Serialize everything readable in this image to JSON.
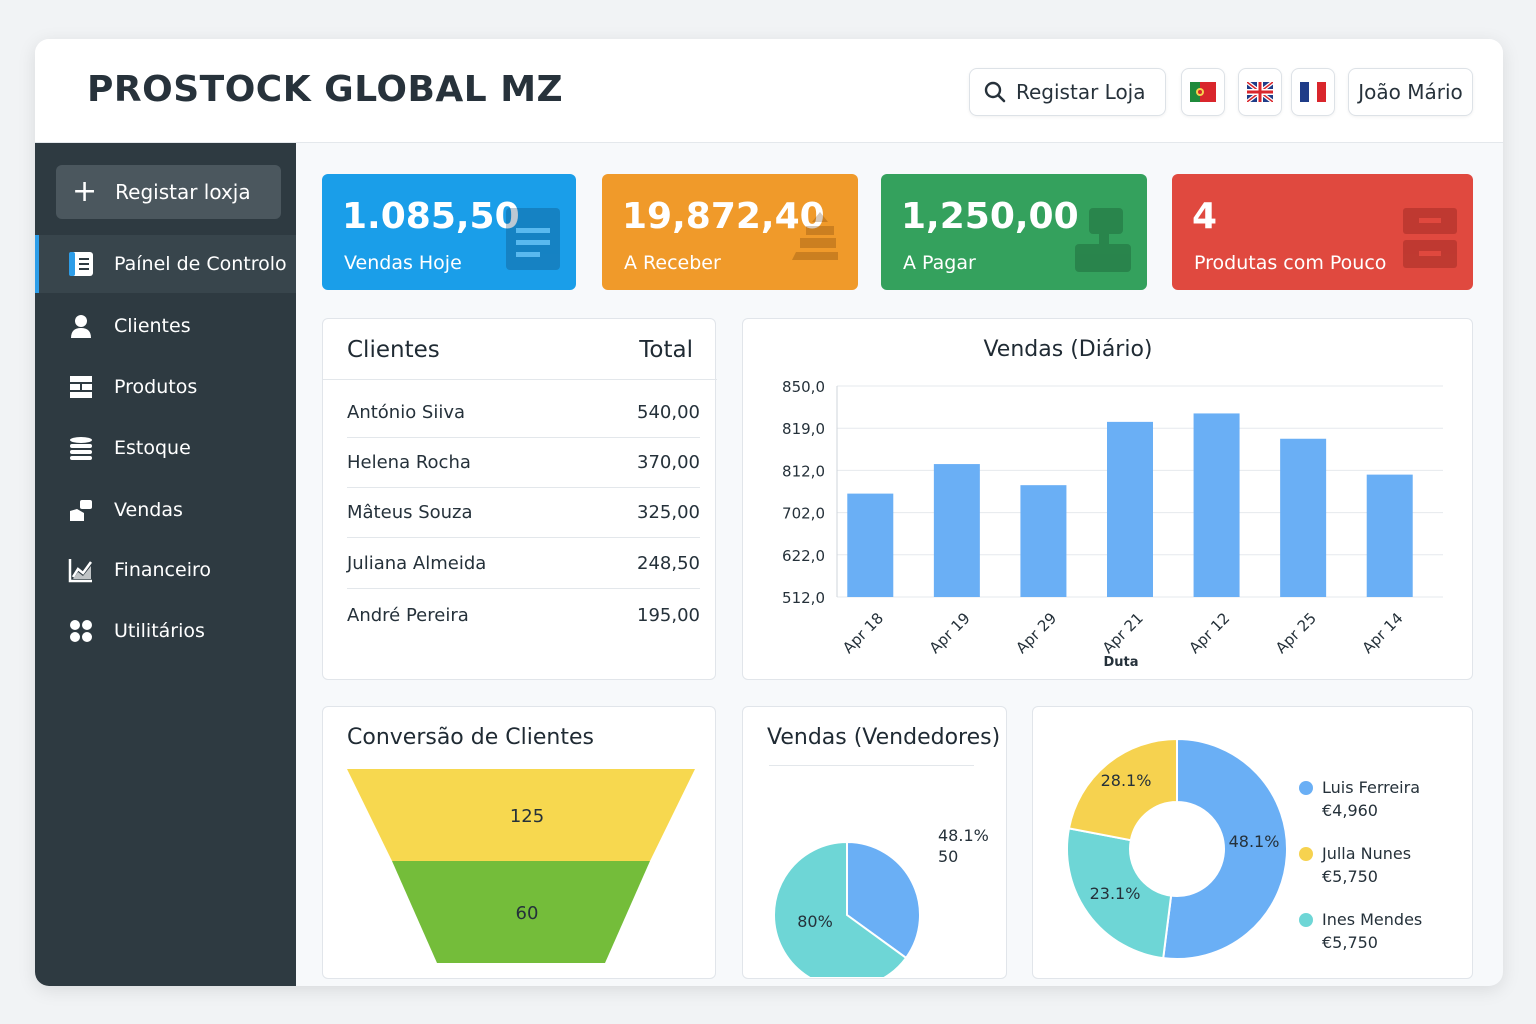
{
  "header": {
    "brand": "PROSTOCK GLOBAL MZ",
    "search_label": "Registar Loja",
    "user_name": "João Mário"
  },
  "sidebar": {
    "add_button": "Registar  loxja",
    "items": [
      {
        "label": "Paínel de Controlo",
        "icon": "dashboard-icon",
        "active": true
      },
      {
        "label": "Clientes",
        "icon": "user-icon"
      },
      {
        "label": "Produtos",
        "icon": "products-icon"
      },
      {
        "label": "Estoque",
        "icon": "stack-icon"
      },
      {
        "label": "Vendas",
        "icon": "sales-icon"
      },
      {
        "label": "Financeiro",
        "icon": "finance-chart-icon"
      },
      {
        "label": "Utilitários",
        "icon": "utilities-icon"
      }
    ]
  },
  "stats": [
    {
      "value": "1.085,50",
      "label": "Vendas Hoje",
      "color": "#1a9ee9"
    },
    {
      "value": "19,872,40",
      "label": "A Receber",
      "color": "#f09a2a"
    },
    {
      "value": "1,250,00",
      "label": "A Pagar",
      "color": "#34a15d"
    },
    {
      "value": "4",
      "label": "Produtas com Pouco",
      "color": "#e0493f"
    }
  ],
  "clients_table": {
    "title": "Clientes",
    "total_header": "Total",
    "rows": [
      {
        "name": "António Siiva",
        "total": "540,00"
      },
      {
        "name": "Helena Rocha",
        "total": "370,00"
      },
      {
        "name": "Mâteus Souza",
        "total": "325,00"
      },
      {
        "name": "Juliana Almeida",
        "total": "248,50"
      },
      {
        "name": "André Pereira",
        "total": "195,00"
      }
    ]
  },
  "chart_data": [
    {
      "type": "bar",
      "title": "Vendas (Diário)",
      "xlabel": "Duta",
      "ylabel": "",
      "categories": [
        "Apr 18",
        "Apr 19",
        "Apr 29",
        "Apr 21",
        "Apr 12",
        "Apr 25",
        "Apr 14"
      ],
      "y_tick_labels": [
        "850,0",
        "819,0",
        "812,0",
        "702,0",
        "622,0",
        "512,0"
      ],
      "bar_level_fraction": [
        0.49,
        0.63,
        0.53,
        0.83,
        0.87,
        0.75,
        0.58
      ],
      "color": "#6aaff5",
      "grid": true
    },
    {
      "type": "funnel",
      "title": "Conversão de Clientes",
      "stages": [
        {
          "value": 125,
          "color": "#f7d84f"
        },
        {
          "value": 60,
          "color": "#74bd3a"
        }
      ]
    },
    {
      "type": "pie",
      "title": "Vendas (Vendedores)",
      "slices": [
        {
          "label": "48.1%",
          "fraction": 0.35,
          "color": "#6aaff5"
        },
        {
          "label": "80%",
          "fraction": 0.65,
          "color": "#6ed6d6"
        }
      ],
      "side_label_pct": "48.1%",
      "side_label_value": "50"
    },
    {
      "type": "pie",
      "donut": true,
      "slices": [
        {
          "label": "48.1%",
          "fraction": 0.52,
          "color": "#6aaff5"
        },
        {
          "label": "23.1%",
          "fraction": 0.26,
          "color": "#6ed6d6"
        },
        {
          "label": "28.1%",
          "fraction": 0.22,
          "color": "#f6d24f"
        }
      ],
      "legend": [
        {
          "name": "Luis Ferreira",
          "value": "€4,960",
          "color": "#6aaff5"
        },
        {
          "name": "Julla Nunes",
          "value": "€5,750",
          "color": "#f6d24f"
        },
        {
          "name": "Ines Mendes",
          "value": "€5,750",
          "color": "#6ed6d6"
        }
      ],
      "legend_position": "right"
    }
  ]
}
